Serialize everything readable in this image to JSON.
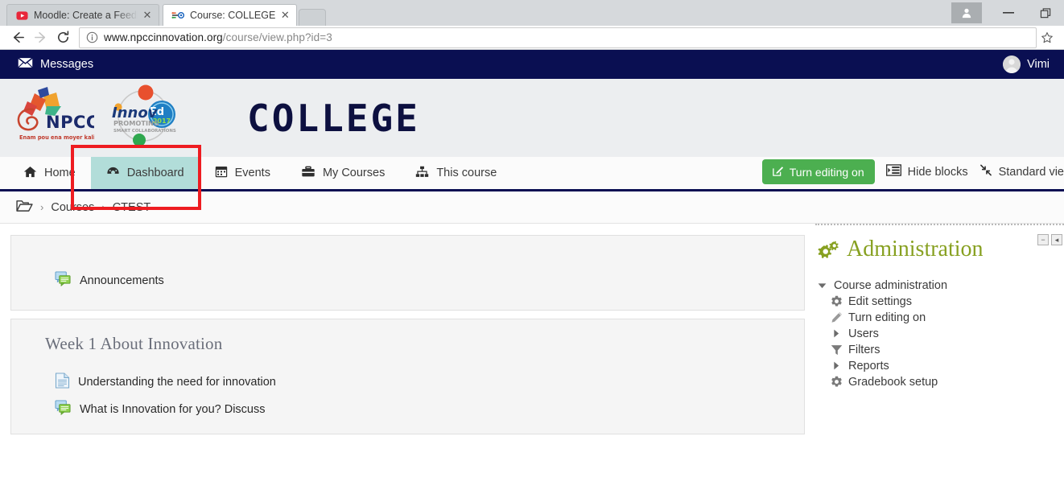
{
  "browser": {
    "tabs": [
      {
        "title": "Moodle: Create a Feedba",
        "favicon": "youtube-icon",
        "active": false
      },
      {
        "title": "Course: COLLEGE",
        "favicon": "moodle-icon",
        "active": true
      }
    ],
    "new_tab_label": "",
    "back_icon": "back-arrow-icon",
    "forward_icon": "forward-arrow-icon",
    "reload_icon": "reload-icon",
    "info_icon": "site-info-icon",
    "star_icon": "bookmark-star-icon",
    "url_domain": "www.npccinnovation.org",
    "url_path": "/course/view.php?id=3",
    "window": {
      "profile_icon": "user-profile-icon",
      "minimize_label": "—",
      "restore_icon": "restore-window-icon"
    }
  },
  "topbar": {
    "messages_label": "Messages",
    "messages_icon": "envelope-icon",
    "user_name": "Vimi",
    "bg_color": "#0a0f52"
  },
  "masthead": {
    "logo_primary": "npcc-logo",
    "logo_primary_text": "NPCC",
    "logo_primary_tagline": "Enam pou ena moyer kalite lavi",
    "logo_secondary": "innoved-logo",
    "logo_secondary_text": "Innov",
    "logo_secondary_badge": "Ed",
    "logo_secondary_year": "2017",
    "logo_secondary_sub1": "PROMOTING",
    "logo_secondary_sub2": "SMART COLLABORATIONS",
    "brand_title": "COLLEGE"
  },
  "nav": {
    "items": [
      {
        "label": "Home",
        "icon": "home-icon",
        "active": false
      },
      {
        "label": "Dashboard",
        "icon": "dashboard-icon",
        "active": true
      },
      {
        "label": "Events",
        "icon": "calendar-icon",
        "active": false
      },
      {
        "label": "My Courses",
        "icon": "briefcase-icon",
        "active": false
      },
      {
        "label": "This course",
        "icon": "sitemap-icon",
        "active": false
      }
    ],
    "turn_editing_on": "Turn editing on",
    "turn_editing_icon": "edit-pencil-square-icon",
    "turn_editing_color": "#4caf50",
    "hide_blocks": "Hide blocks",
    "hide_blocks_icon": "blocks-list-icon",
    "standard_view": "Standard vie",
    "standard_view_icon": "compress-arrows-icon",
    "highlight_color": "#ee1c21",
    "active_bg": "#b2ddd9"
  },
  "breadcrumb": {
    "folder_icon": "folder-open-icon",
    "items": [
      "Courses",
      "CTEST"
    ],
    "separator": "›"
  },
  "course": {
    "announcements": {
      "label": "Announcements",
      "icon": "forum-icon"
    },
    "section_title": "Week 1 About Innovation",
    "activities": [
      {
        "label": "Understanding the need for innovation",
        "icon": "page-document-icon"
      },
      {
        "label": "What is Innovation for you? Discuss",
        "icon": "forum-icon"
      }
    ]
  },
  "admin_block": {
    "title": "Administration",
    "title_icon": "cogs-icon",
    "title_color": "#87a020",
    "action_minimize": "−",
    "action_dock": "◂",
    "tree": [
      {
        "label": "Course administration",
        "icon": "caret-down-icon",
        "level": 0
      },
      {
        "label": "Edit settings",
        "icon": "gear-icon",
        "level": 1
      },
      {
        "label": "Turn editing on",
        "icon": "pencil-icon",
        "level": 1
      },
      {
        "label": "Users",
        "icon": "caret-right-icon",
        "level": 1
      },
      {
        "label": "Filters",
        "icon": "filter-funnel-icon",
        "level": 1
      },
      {
        "label": "Reports",
        "icon": "caret-right-icon",
        "level": 1
      },
      {
        "label": "Gradebook setup",
        "icon": "gradebook-icon",
        "level": 1
      }
    ]
  }
}
